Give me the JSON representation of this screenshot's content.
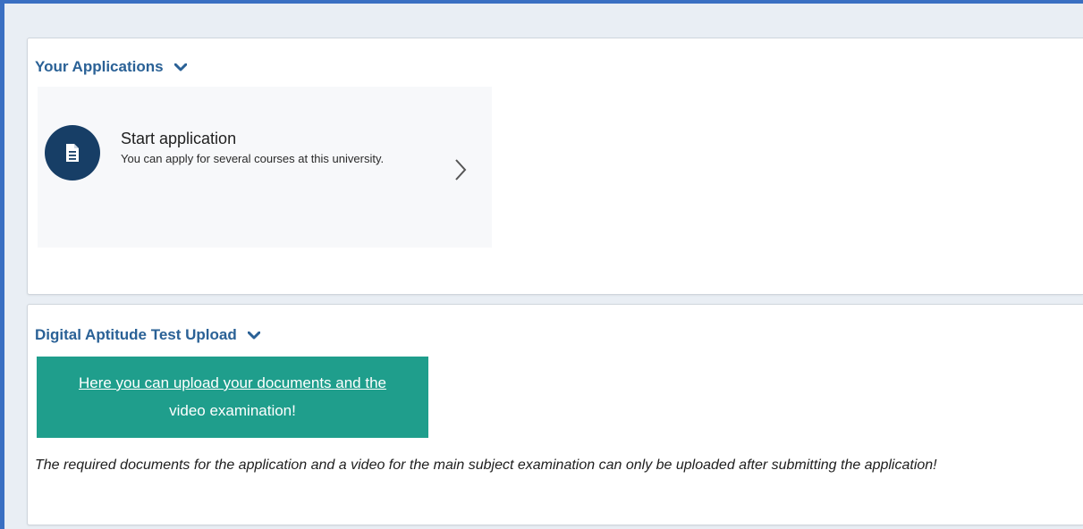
{
  "applications_section": {
    "title": "Your Applications",
    "card": {
      "title": "Start application",
      "description": "You can apply for several courses at this university.",
      "icon": "document-icon"
    }
  },
  "upload_section": {
    "title": "Digital Aptitude Test Upload",
    "button_line1": "Here you can upload your documents and the",
    "button_line2": "video examination!",
    "note": "The required documents for the application and a video for the main subject examination can only be uploaded after submitting the application!"
  },
  "colors": {
    "frame_accent": "#3a6fc2",
    "header_text": "#2a6196",
    "icon_circle": "#173e66",
    "upload_button": "#1f9e8c"
  }
}
